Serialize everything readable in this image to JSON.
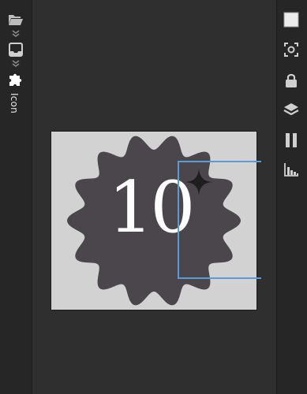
{
  "left_toolbar": {
    "panel_label": "Icon",
    "items": [
      {
        "icon": "folder-open-icon"
      },
      {
        "icon": "inbox-tray-icon"
      },
      {
        "icon": "puzzle-piece-icon"
      }
    ]
  },
  "right_toolbar": {
    "items": [
      {
        "icon": "square-swatch-icon"
      },
      {
        "icon": "focus-capture-icon"
      },
      {
        "icon": "lock-icon"
      },
      {
        "icon": "layers-icon"
      },
      {
        "icon": "pause-icon"
      },
      {
        "icon": "bar-chart-icon"
      }
    ]
  },
  "canvas": {
    "badge_text": "10",
    "colors": {
      "artboard_bg": "#d2d2d2",
      "badge_fill": "#4a464b",
      "number_color": "#ffffff",
      "sparkle_color": "#1e1e1e",
      "selection_color": "#5b9bd6"
    }
  }
}
